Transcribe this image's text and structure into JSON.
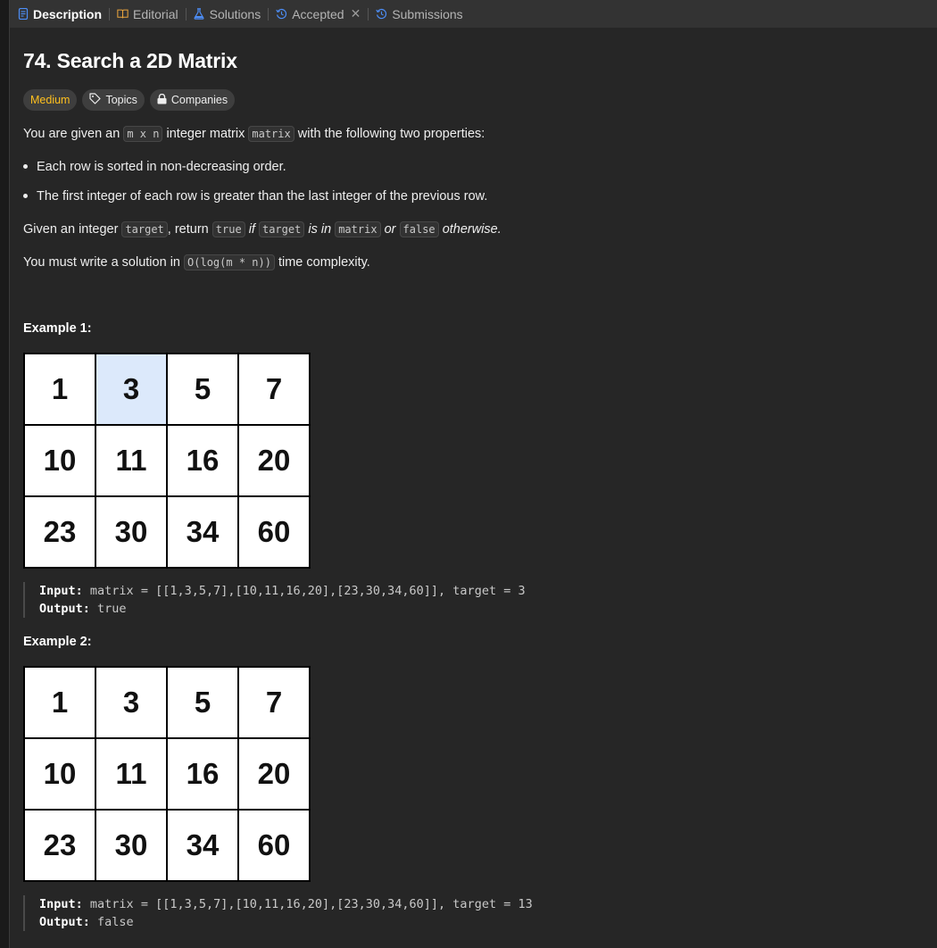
{
  "tabs": [
    {
      "label": "Description",
      "icon": "document-icon"
    },
    {
      "label": "Editorial",
      "icon": "book-icon"
    },
    {
      "label": "Solutions",
      "icon": "flask-icon"
    },
    {
      "label": "Accepted",
      "icon": "history-icon"
    },
    {
      "label": "Submissions",
      "icon": "history-icon"
    }
  ],
  "problem": {
    "title": "74. Search a 2D Matrix",
    "difficulty": "Medium",
    "topics_label": "Topics",
    "companies_label": "Companies"
  },
  "description": {
    "p1_a": "You are given an",
    "p1_code1": "m x n",
    "p1_b": "integer matrix",
    "p1_code2": "matrix",
    "p1_c": "with the following two properties:",
    "bullets": [
      "Each row is sorted in non-decreasing order.",
      "The first integer of each row is greater than the last integer of the previous row."
    ],
    "p2_a": "Given an integer",
    "p2_code1": "target",
    "p2_b": ", return",
    "p2_code2": "true",
    "p2_c": "if",
    "p2_code3": "target",
    "p2_d": "is in",
    "p2_code4": "matrix",
    "p2_e": "or",
    "p2_code5": "false",
    "p2_f": "otherwise.",
    "p3_a": "You must write a solution in",
    "p3_code": "O(log(m * n))",
    "p3_b": "time complexity."
  },
  "examples": [
    {
      "title": "Example 1:",
      "matrix": [
        [
          1,
          3,
          5,
          7
        ],
        [
          10,
          11,
          16,
          20
        ],
        [
          23,
          30,
          34,
          60
        ]
      ],
      "highlight": [
        0,
        1
      ],
      "input_label": "Input:",
      "input_value": "matrix = [[1,3,5,7],[10,11,16,20],[23,30,34,60]], target = 3",
      "output_label": "Output:",
      "output_value": "true"
    },
    {
      "title": "Example 2:",
      "matrix": [
        [
          1,
          3,
          5,
          7
        ],
        [
          10,
          11,
          16,
          20
        ],
        [
          23,
          30,
          34,
          60
        ]
      ],
      "highlight": null,
      "input_label": "Input:",
      "input_value": "matrix = [[1,3,5,7],[10,11,16,20],[23,30,34,60]], target = 13",
      "output_label": "Output:",
      "output_value": "false"
    }
  ],
  "colors": {
    "background": "#262626",
    "tabbar": "#333333",
    "medium": "#ffc01e",
    "highlight_cell": "#dce9fb"
  }
}
